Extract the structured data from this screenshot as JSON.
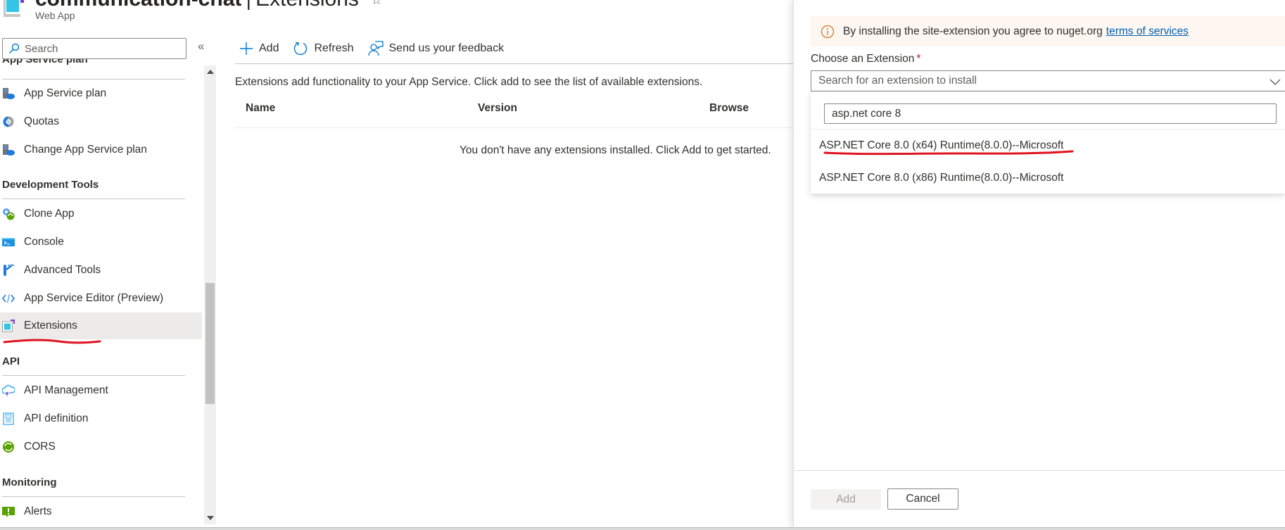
{
  "header": {
    "resource_name": "communication-chat",
    "separator": "|",
    "page_name": "Extensions",
    "subtitle": "Web App",
    "favorite_icon": "star-icon"
  },
  "sidebar": {
    "search_placeholder": "Search",
    "collapse_label": "«",
    "groups": [
      {
        "title": "App Service plan",
        "items": [
          {
            "label": "App Service plan",
            "icon": "app-service-plan-icon"
          },
          {
            "label": "Quotas",
            "icon": "quotas-icon"
          },
          {
            "label": "Change App Service plan",
            "icon": "change-plan-icon"
          }
        ]
      },
      {
        "title": "Development Tools",
        "items": [
          {
            "label": "Clone App",
            "icon": "clone-app-icon"
          },
          {
            "label": "Console",
            "icon": "console-icon"
          },
          {
            "label": "Advanced Tools",
            "icon": "advanced-tools-icon"
          },
          {
            "label": "App Service Editor (Preview)",
            "icon": "code-editor-icon"
          },
          {
            "label": "Extensions",
            "icon": "extensions-icon",
            "active": true
          }
        ]
      },
      {
        "title": "API",
        "items": [
          {
            "label": "API Management",
            "icon": "api-management-icon"
          },
          {
            "label": "API definition",
            "icon": "api-definition-icon"
          },
          {
            "label": "CORS",
            "icon": "cors-icon"
          }
        ]
      },
      {
        "title": "Monitoring",
        "items": [
          {
            "label": "Alerts",
            "icon": "alerts-icon"
          }
        ]
      }
    ]
  },
  "toolbar": {
    "add_label": "Add",
    "refresh_label": "Refresh",
    "feedback_label": "Send us your feedback"
  },
  "main": {
    "description": "Extensions add functionality to your App Service. Click add to see the list of available extensions.",
    "columns": [
      "Name",
      "Version",
      "Browse"
    ],
    "empty_message": "You don't have any extensions installed. Click Add to get started."
  },
  "panel": {
    "info_text": "By installing the site-extension you agree to nuget.org",
    "info_link": "terms of services",
    "choose_label": "Choose an Extension",
    "required_mark": "*",
    "select_placeholder": "Search for an extension to install",
    "search_value": "asp.net core 8",
    "options": [
      "ASP.NET Core 8.0 (x64) Runtime(8.0.0)--Microsoft",
      "ASP.NET Core 8.0 (x86) Runtime(8.0.0)--Microsoft"
    ],
    "add_button": "Add",
    "cancel_button": "Cancel"
  },
  "colors": {
    "accent": "#0078d4",
    "link": "#0063b1",
    "info_background": "#fdf6f1",
    "info_icon": "#d47a2a",
    "annotation_red": "#e0141e",
    "active_row": "#edebe9"
  }
}
